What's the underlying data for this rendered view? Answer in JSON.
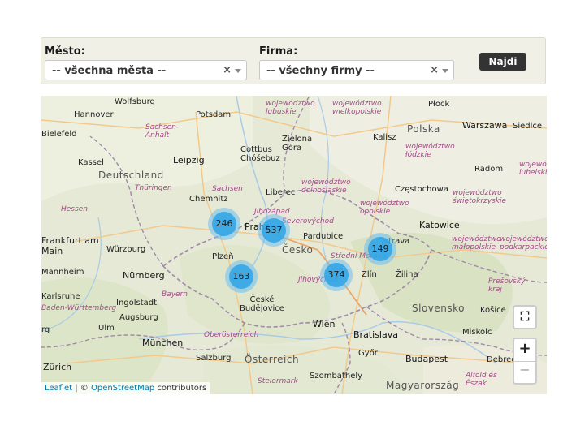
{
  "filters": {
    "city": {
      "label": "Město:",
      "value": "-- všechna města --",
      "clear": "×"
    },
    "company": {
      "label": "Firma:",
      "value": "-- všechny firmy --",
      "clear": "×"
    },
    "search_button": "Najdi"
  },
  "map": {
    "clusters": [
      {
        "count": "246"
      },
      {
        "count": "537"
      },
      {
        "count": "163"
      },
      {
        "count": "374"
      },
      {
        "count": "149"
      }
    ],
    "labels": {
      "hannover": "Hannover",
      "wolfsburg": "Wolfsburg",
      "potsdam": "Potsdam",
      "bielefeld": "Bielefeld",
      "sachsen_anhalt": "Sachsen-\nAnhalt",
      "deutschland": "Deutschland",
      "kassel": "Kassel",
      "leipzig": "Leipzig",
      "cottbus": "Cottbus\nChóśebuz",
      "zielona": "Zielona\nGóra",
      "lubuskie": "województwo\nlubuskie",
      "wielkopolskie": "województwo\nwielkopolskie",
      "plock": "Płock",
      "polska": "Polska",
      "warszawa": "Warszawa",
      "siedlce": "Siedlce",
      "kalisz": "Kalisz",
      "lodzkie": "województwo\nłódzkie",
      "radom": "Radom",
      "lubelskie": "województwo\nlubelskie",
      "thuringen": "Thüringen",
      "chemnitz": "Chemnitz",
      "sachsen": "Sachsen",
      "liberec": "Liberec",
      "dolnoslaskie": "województwo\ndolnośląskie",
      "czestochowa": "Częstochowa",
      "swietokrzyskie": "województwo\nświętokrzyskie",
      "opolskie": "województwo\nopolskie",
      "hessen": "Hessen",
      "severovychod": "Severovýchod",
      "praha": "Praha",
      "pardubice": "Pardubice",
      "katowice": "Katowice",
      "frankfurt": "Frankfurt am\nMain",
      "wurzburg": "Würzburg",
      "plzen": "Plzeň",
      "cesko": "Česko",
      "stredni_morava": "Střední Morava",
      "ostrava": "Ostrava",
      "malopolskie": "województwo\nmałopolskie",
      "podkarpackie": "województwo\npodkarpackie",
      "mannheim": "Mannheim",
      "nurnberg": "Nürnberg",
      "zlin": "Zlín",
      "zilina": "Žilina",
      "presovsky": "Prešovský\nkraj",
      "karlsruhe": "Karlsruhe",
      "bayern": "Bayern",
      "jihovychod": "Jihovýchod",
      "baden": "Baden-Württemberg",
      "ingolstadt": "Ingolstadt",
      "ceske_budejovice": "České\nBudějovice",
      "slovensko": "Slovensko",
      "kosice": "Košice",
      "augsburg": "Augsburg",
      "stuttgart_g": "rg",
      "ulm": "Ulm",
      "oberosterreich": "Oberösterreich",
      "wien": "Wien",
      "bratislava": "Bratislava",
      "miskolc": "Miskolc",
      "munchen": "München",
      "salzburg": "Salzburg",
      "osterreich": "Österreich",
      "gyor": "Győr",
      "budapest": "Budapest",
      "debrecen": "Debrece",
      "zurich": "Zürich",
      "steiermark": "Steiermark",
      "szombathely": "Szombathely",
      "magyarorszag": "Magyarország",
      "alfold": "Alföld és\nÉszak",
      "jihozapad": "Jihozápad"
    },
    "controls": {
      "fullscreen": "⛶",
      "zoom_in": "+",
      "zoom_out": "−"
    },
    "attribution": {
      "leaflet": "Leaflet",
      "sep": " | © ",
      "osm": "OpenStreetMap",
      "suffix": " contributors"
    }
  }
}
